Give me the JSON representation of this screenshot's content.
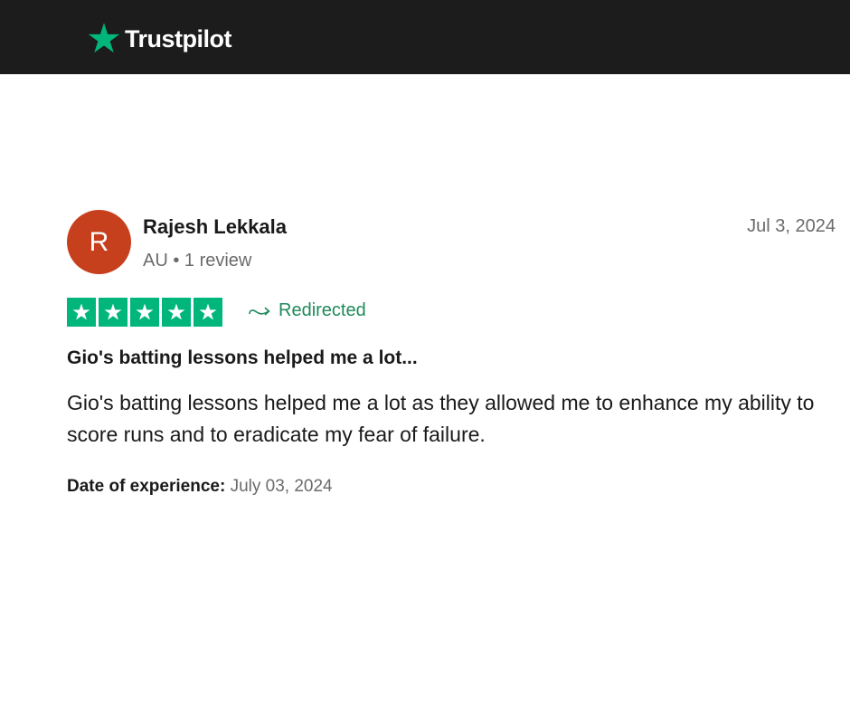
{
  "header": {
    "brand": "Trustpilot",
    "brand_color": "#00b67a",
    "logo_icon": "star-icon"
  },
  "review": {
    "avatar_letter": "R",
    "avatar_color": "#c7401e",
    "reviewer_name": "Rajesh Lekkala",
    "reviewer_meta": "AU • 1 review",
    "date": "Jul 3, 2024",
    "rating": 5,
    "rating_max": 5,
    "redirected_label": "Redirected",
    "title": "Gio's batting lessons helped me a lot...",
    "body": "Gio's batting lessons helped me a lot as they allowed me to enhance my ability to score runs and to eradicate my fear of failure.",
    "experience_label": "Date of experience:",
    "experience_value": "July 03, 2024"
  }
}
